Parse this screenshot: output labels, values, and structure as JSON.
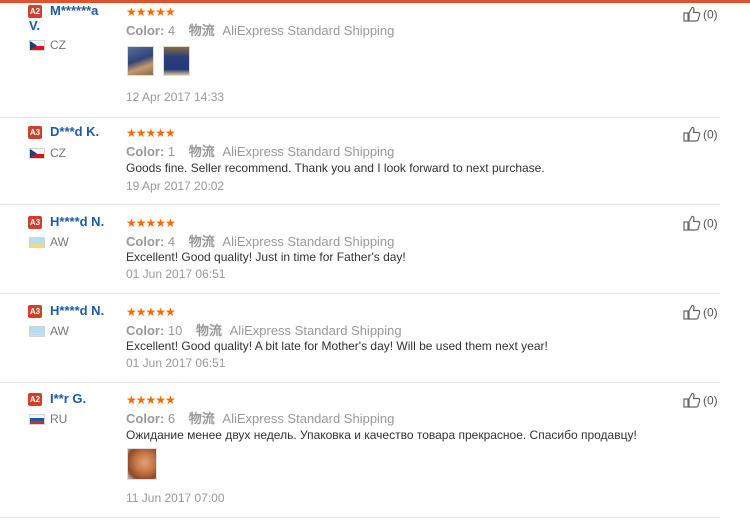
{
  "reviews": [
    {
      "badge": "A2",
      "name": "M******a",
      "name_cont": "V.",
      "country": "CZ",
      "stars": "★★★★★",
      "color_label": "Color:",
      "color_value": "4",
      "shipping_cn": "物流",
      "shipping": "AliExpress Standard Shipping",
      "text": "",
      "date": "12 Apr 2017 14:33",
      "likes": "(0)"
    },
    {
      "badge": "A3",
      "name": "D***d K.",
      "country": "CZ",
      "stars": "★★★★★",
      "color_label": "Color:",
      "color_value": "1",
      "shipping_cn": "物流",
      "shipping": "AliExpress Standard Shipping",
      "text": "Goods fine. Seller recommend. Thank you and I look forward to next purchase.",
      "date": "19 Apr 2017 20:02",
      "likes": "(0)"
    },
    {
      "badge": "A3",
      "name": "H****d N.",
      "country": "AW",
      "stars": "★★★★★",
      "color_label": "Color:",
      "color_value": "4",
      "shipping_cn": "物流",
      "shipping": "AliExpress Standard Shipping",
      "text": "Excellent! Good quality! Just in time for Father's day!",
      "date": "01 Jun 2017 06:51",
      "likes": "(0)"
    },
    {
      "badge": "A3",
      "name": "H****d N.",
      "country": "AW",
      "stars": "★★★★★",
      "color_label": "Color:",
      "color_value": "10",
      "shipping_cn": "物流",
      "shipping": "AliExpress Standard Shipping",
      "text": "Excellent! Good quality! A bit late for Mother's day! Will be used them next year!",
      "date": "01 Jun 2017 06:51",
      "likes": "(0)"
    },
    {
      "badge": "A2",
      "name": "I**r G.",
      "country": "RU",
      "stars": "★★★★★",
      "color_label": "Color:",
      "color_value": "6",
      "shipping_cn": "物流",
      "shipping": "AliExpress Standard Shipping",
      "text": "Ожидание менее двух недель. Упаковка и качество товара прекрасное. Спасибо продавцу!",
      "date": "11 Jun 2017 07:00",
      "likes": "(0)"
    }
  ]
}
